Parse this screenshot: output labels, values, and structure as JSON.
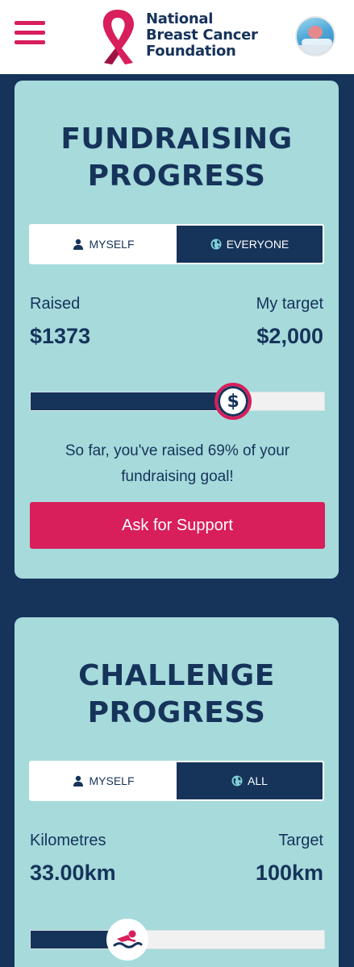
{
  "header": {
    "logo_lines": [
      "National",
      "Breast Cancer",
      "Foundation"
    ],
    "menu_icon": "hamburger-menu-icon",
    "avatar": "user-avatar-photo"
  },
  "fundraising": {
    "title_lines": [
      "FUNDRAISING",
      "PROGRESS"
    ],
    "toggle": {
      "option1": {
        "label": "MYSELF",
        "icon": "person-icon",
        "selected": false
      },
      "option2": {
        "label": "EVERYONE",
        "icon": "globe-icon",
        "selected": true
      }
    },
    "raised_label": "Raised",
    "raised_value": "$1373",
    "target_label": "My target",
    "target_value": "$2,000",
    "progress_fraction": 0.69,
    "marker_symbol": "$",
    "progress_text_line1": "So far, you've raised 69% of your",
    "progress_text_line2": "fundraising goal!",
    "cta_label": "Ask for Support"
  },
  "challenge": {
    "title_lines": [
      "CHALLENGE",
      "PROGRESS"
    ],
    "toggle": {
      "option1": {
        "label": "MYSELF",
        "icon": "person-icon",
        "selected": false
      },
      "option2": {
        "label": "ALL",
        "icon": "globe-icon",
        "selected": true
      }
    },
    "km_label": "Kilometres",
    "km_value": "33.00km",
    "target_label": "Target",
    "target_value": "100km",
    "progress_fraction": 0.33,
    "marker_icon": "swimmer-icon"
  },
  "colors": {
    "navy": "#16335a",
    "pink": "#d81e5b",
    "card_teal": "#a6dadb",
    "white": "#ffffff"
  }
}
